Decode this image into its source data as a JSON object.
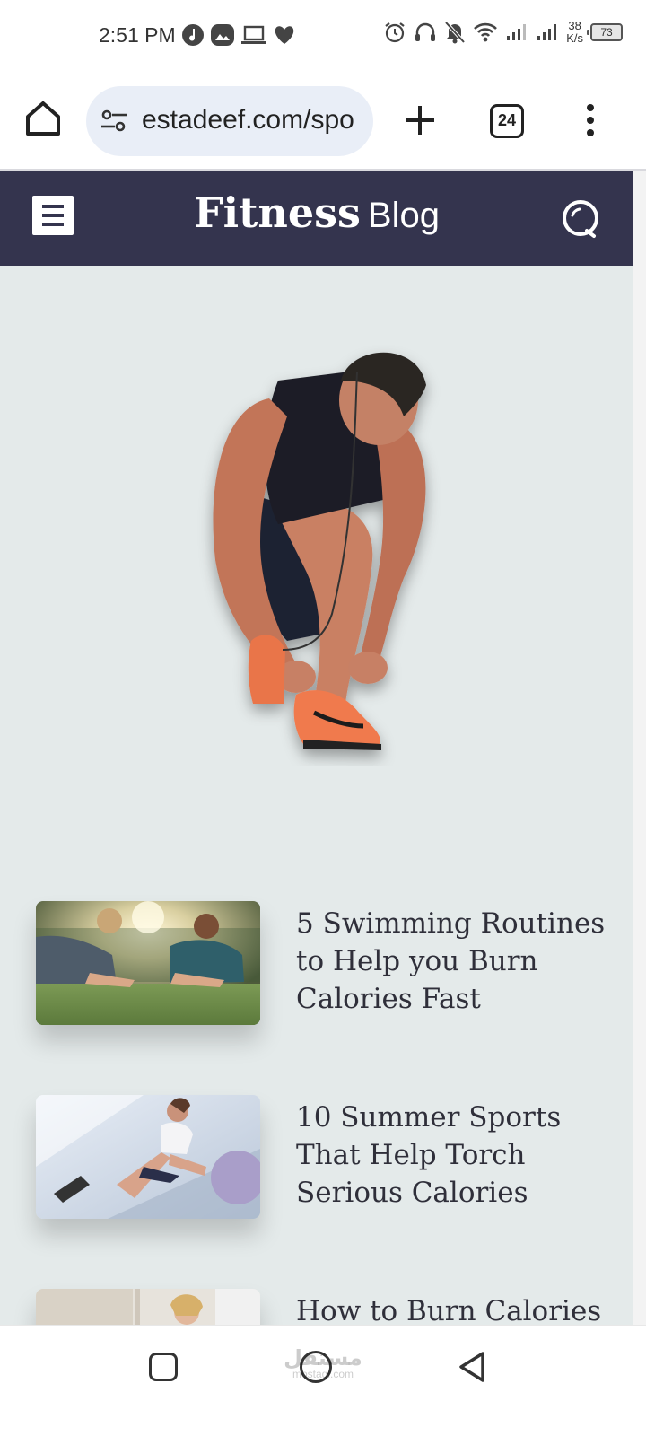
{
  "status_bar": {
    "time": "2:51 PM",
    "net_speed_value": "38",
    "net_speed_unit": "K/s",
    "battery": "73",
    "left_icons": [
      "music-icon",
      "gallery-icon",
      "laptop-icon",
      "heart-icon"
    ],
    "right_icons": [
      "alarm-icon",
      "headphones-icon",
      "bell-off-icon",
      "wifi-icon",
      "signal-icon",
      "signal-icon"
    ]
  },
  "browser": {
    "url": "estadeef.com/spo",
    "tab_count": "24"
  },
  "site": {
    "title_bold": "Fitness",
    "title_light": "Blog",
    "colors": {
      "header_bg": "#34344e",
      "content_bg": "#e4eaea",
      "title_text": "#2f2f3a"
    }
  },
  "posts": [
    {
      "title": "5 Swimming Routines to Help you Burn Calories Fast",
      "thumb": "couple-plank-photo"
    },
    {
      "title": "10 Summer Sports That Help Torch Serious Calories",
      "thumb": "woman-stretching-photo"
    },
    {
      "title": "How to Burn Calories",
      "thumb": "woman-indoor-photo"
    }
  ],
  "watermark": {
    "arabic": "مستقل",
    "latin": "mostaql.com"
  }
}
